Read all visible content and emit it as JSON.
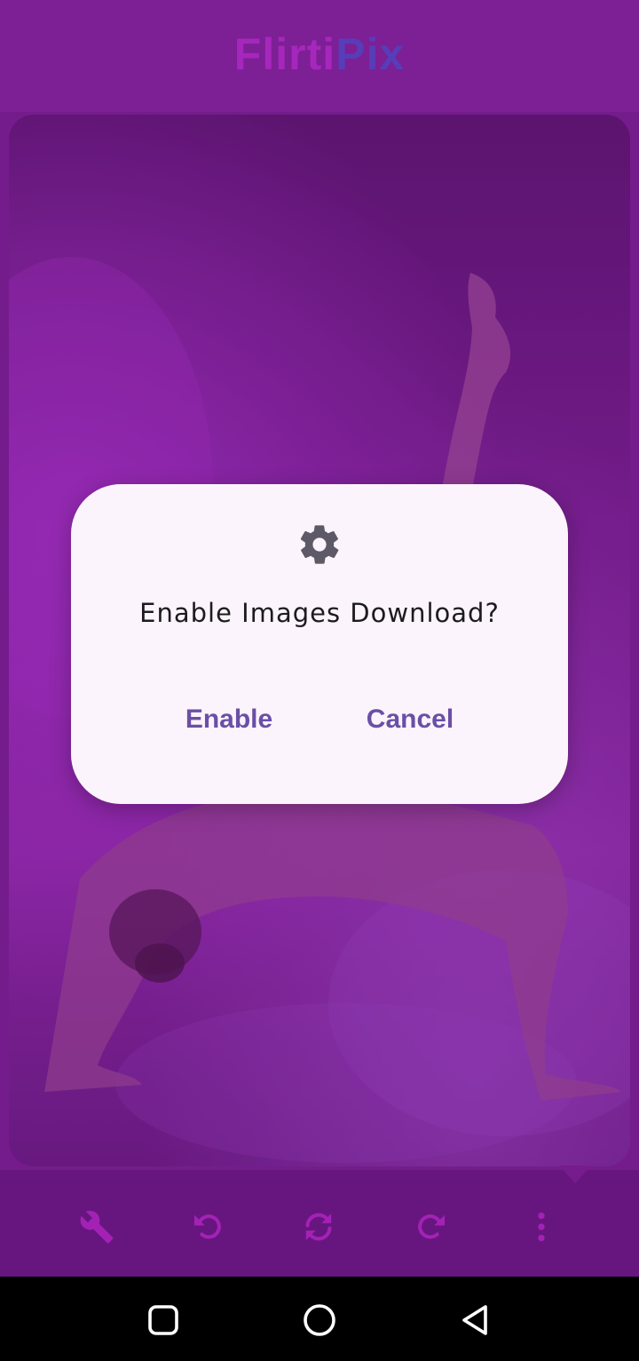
{
  "app": {
    "logo_part1": "Flirti",
    "logo_part2": "Pix",
    "logo_color_1": "#b32ccb",
    "logo_color_2": "#5a45c6"
  },
  "dialog": {
    "icon": "gear-icon",
    "title": "Enable Images Download?",
    "enable_label": "Enable",
    "cancel_label": "Cancel",
    "button_color": "#6a4fa6"
  },
  "toolbar": {
    "items": [
      {
        "name": "settings-wrench-icon"
      },
      {
        "name": "rotate-left-icon"
      },
      {
        "name": "refresh-icon"
      },
      {
        "name": "rotate-right-icon"
      },
      {
        "name": "more-options-icon"
      }
    ],
    "icon_color": "#b026c3"
  },
  "navigation": {
    "items": [
      {
        "name": "recents-icon"
      },
      {
        "name": "home-icon"
      },
      {
        "name": "back-icon"
      }
    ]
  },
  "colors": {
    "appbar": "#84239f",
    "toolbar": "#6c1886",
    "dialog_bg": "#fcf4fc"
  }
}
